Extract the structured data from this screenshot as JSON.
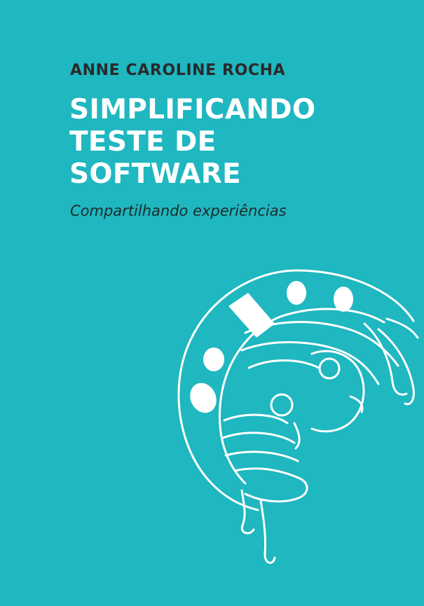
{
  "cover": {
    "author": "ANNE CAROLINE ROCHA",
    "title_lines": [
      "SIMPLIFICANDO",
      "TESTE DE",
      "SOFTWARE"
    ],
    "subtitle": "Compartilhando experiências",
    "illustration": "ladybug-outline-icon",
    "colors": {
      "background": "#1fb7c0",
      "title": "#ffffff",
      "author": "#2a2a2a",
      "subtitle": "#1e2a2c",
      "line_art": "#ffffff"
    }
  }
}
